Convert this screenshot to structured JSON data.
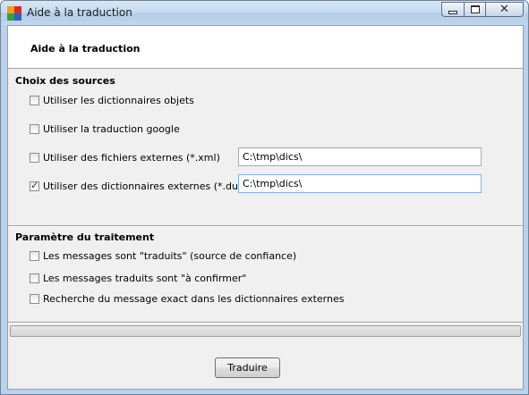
{
  "window": {
    "title": "Aide à la traduction",
    "controls": {
      "minimize": "minimize",
      "maximize": "maximize",
      "close": "close"
    }
  },
  "header": {
    "title": "Aide à la traduction"
  },
  "sources": {
    "title": "Choix des sources",
    "options": [
      {
        "label": "Utiliser les dictionnaires objets",
        "checked": false
      },
      {
        "label": "Utiliser la traduction google",
        "checked": false
      },
      {
        "label": "Utiliser des fichiers externes (*.xml)",
        "checked": false,
        "path": "C:\\tmp\\dics\\"
      },
      {
        "label": "Utiliser des dictionnaires externes (*.dut)",
        "checked": true,
        "path": "C:\\tmp\\dics\\"
      }
    ]
  },
  "treatment": {
    "title": "Paramètre du traitement",
    "options": [
      {
        "label": "Les messages sont \"traduits\" (source de confiance)",
        "checked": false
      },
      {
        "label": "Les messages traduits sont \"à confirmer\"",
        "checked": false
      },
      {
        "label": "Recherche du message exact dans les dictionnaires externes",
        "checked": false
      }
    ]
  },
  "progress": {
    "value": 0
  },
  "actions": {
    "translate_label": "Traduire"
  }
}
